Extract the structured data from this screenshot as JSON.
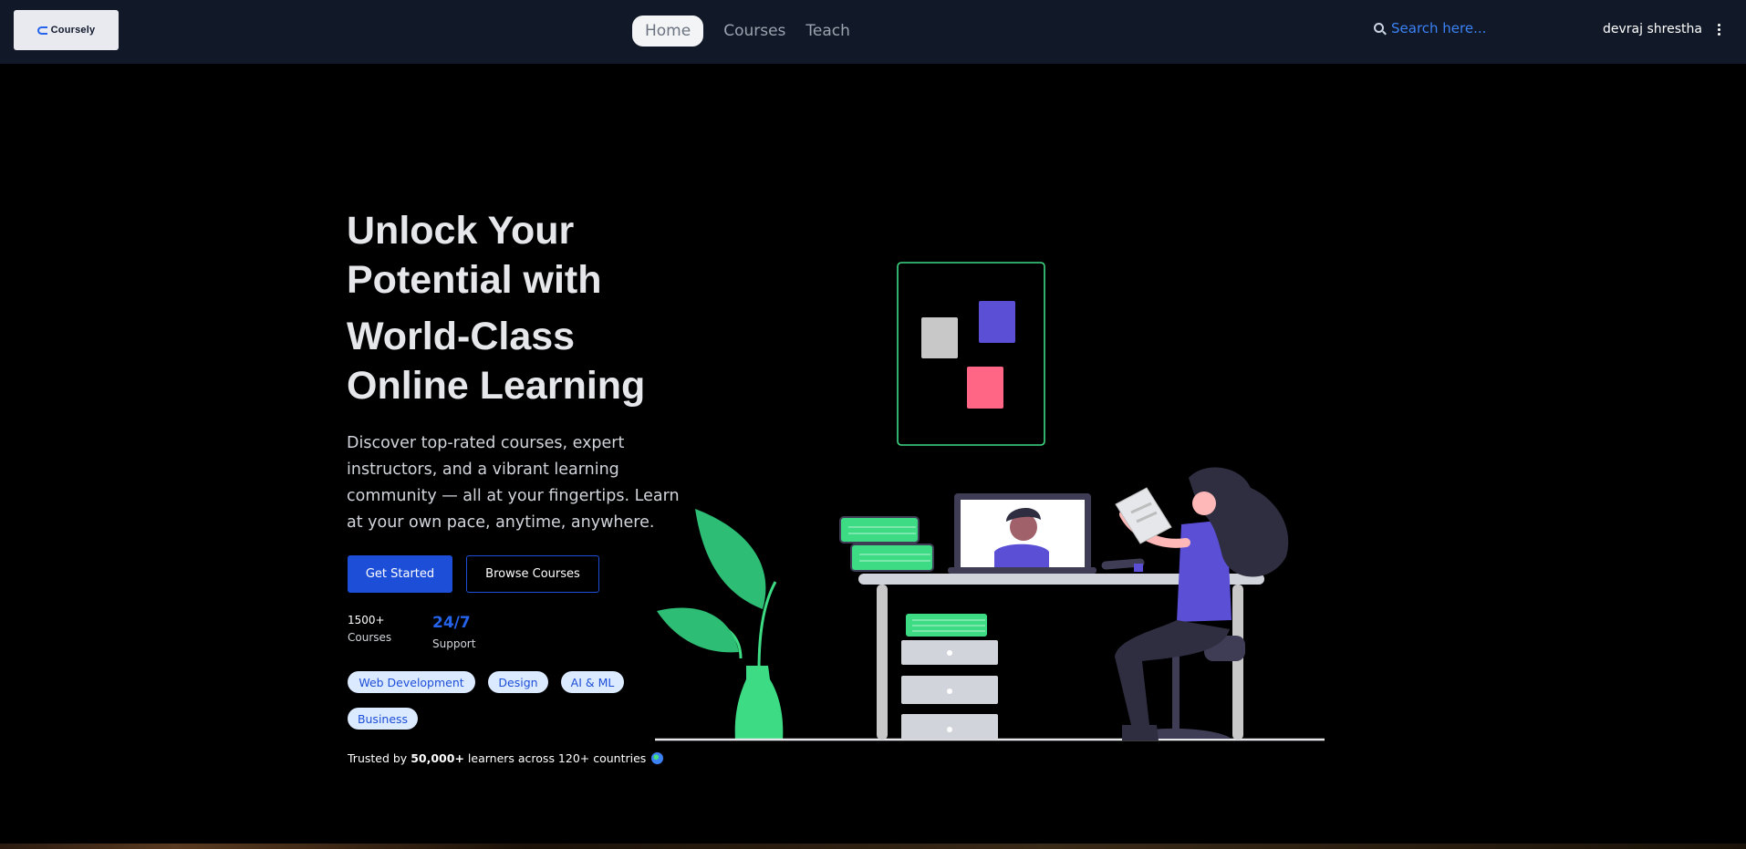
{
  "nav": {
    "logo_text": "Coursely",
    "links": [
      {
        "label": "Home",
        "active": true
      },
      {
        "label": "Courses",
        "active": false
      },
      {
        "label": "Teach",
        "active": false
      }
    ],
    "search_placeholder": "Search here...",
    "user_name": "devraj shrestha"
  },
  "hero": {
    "title_lines": [
      "Unlock Your",
      "Potential with",
      "World-Class",
      "Online Learning"
    ],
    "description": "Discover top-rated courses, expert instructors, and a vibrant learning community — all at your fingertips. Learn at your own pace, anytime, anywhere.",
    "primary_button": "Get Started",
    "secondary_button": "Browse Courses",
    "stats": [
      {
        "value": "1500+",
        "label": "Courses"
      },
      {
        "value": "24/7",
        "label": "Support"
      }
    ],
    "tags": [
      "Web Development",
      "Design",
      "AI & ML",
      "Business"
    ],
    "trusted": {
      "prefix": "Trusted by",
      "count": "50,000+",
      "suffix": "learners across 120+ countries"
    }
  },
  "colors": {
    "navbar_bg": "#111827",
    "accent_blue": "#1d4ed8",
    "tag_bg": "#dbeafe",
    "illustration_green": "#3ddc84",
    "illustration_purple": "#5b4fd6",
    "illustration_pink": "#ff6584"
  },
  "icons": [
    "search-icon",
    "kebab-menu-icon",
    "globe-icon"
  ]
}
